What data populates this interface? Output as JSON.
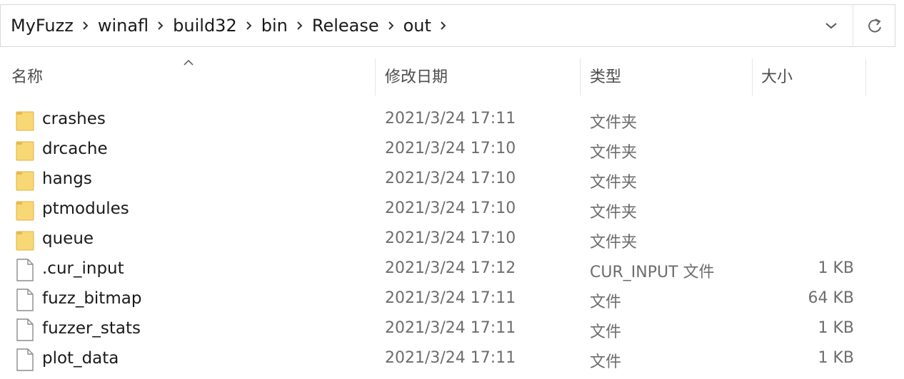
{
  "address_bar": {
    "breadcrumbs": [
      "MyFuzz",
      "winafl",
      "build32",
      "bin",
      "Release",
      "out"
    ],
    "dropdown_icon": "chevron-down-icon",
    "refresh_icon": "refresh-icon"
  },
  "columns": {
    "name": "名称",
    "date_modified": "修改日期",
    "type": "类型",
    "size": "大小",
    "sort_indicator": "^"
  },
  "files": [
    {
      "name": "crashes",
      "date": "2021/3/24 17:11",
      "type": "文件夹",
      "size": "",
      "icon": "folder-icon"
    },
    {
      "name": "drcache",
      "date": "2021/3/24 17:10",
      "type": "文件夹",
      "size": "",
      "icon": "folder-icon"
    },
    {
      "name": "hangs",
      "date": "2021/3/24 17:10",
      "type": "文件夹",
      "size": "",
      "icon": "folder-icon"
    },
    {
      "name": "ptmodules",
      "date": "2021/3/24 17:10",
      "type": "文件夹",
      "size": "",
      "icon": "folder-icon"
    },
    {
      "name": "queue",
      "date": "2021/3/24 17:10",
      "type": "文件夹",
      "size": "",
      "icon": "folder-icon"
    },
    {
      "name": ".cur_input",
      "date": "2021/3/24 17:12",
      "type": "CUR_INPUT 文件",
      "size": "1 KB",
      "icon": "file-icon"
    },
    {
      "name": "fuzz_bitmap",
      "date": "2021/3/24 17:11",
      "type": "文件",
      "size": "64 KB",
      "icon": "file-icon"
    },
    {
      "name": "fuzzer_stats",
      "date": "2021/3/24 17:11",
      "type": "文件",
      "size": "1 KB",
      "icon": "file-icon"
    },
    {
      "name": "plot_data",
      "date": "2021/3/24 17:11",
      "type": "文件",
      "size": "1 KB",
      "icon": "file-icon"
    }
  ],
  "colors": {
    "folder_fill": "#f8d775",
    "folder_tab": "#e8b94a",
    "file_border": "#8c8c8c"
  }
}
